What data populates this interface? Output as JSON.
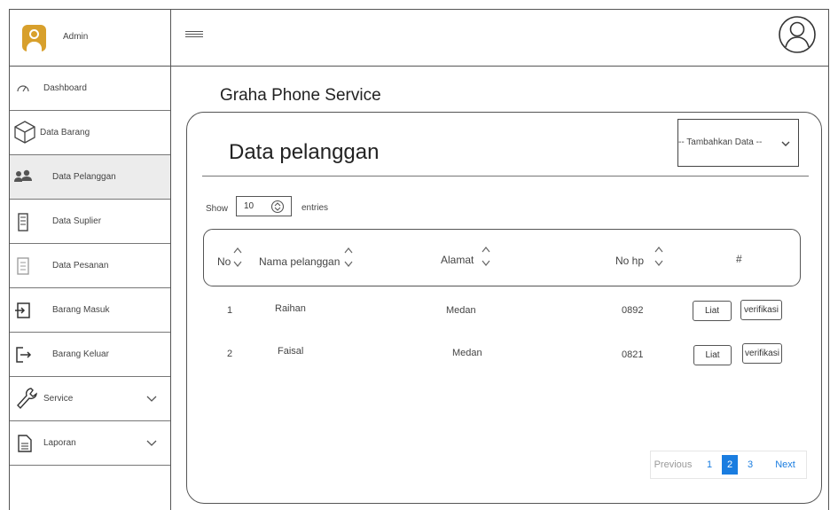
{
  "header": {
    "admin_label": "Admin"
  },
  "sidebar": {
    "items": [
      {
        "label": "Dashboard"
      },
      {
        "label": "Data Barang"
      },
      {
        "label": "Data Pelanggan"
      },
      {
        "label": "Data Suplier"
      },
      {
        "label": "Data Pesanan"
      },
      {
        "label": "Barang Masuk"
      },
      {
        "label": "Barang Keluar"
      },
      {
        "label": "Service"
      },
      {
        "label": "Laporan"
      }
    ],
    "active_item": "Data Pelanggan"
  },
  "main": {
    "app_title": "Graha Phone Service",
    "panel_title": "Data pelanggan",
    "add_select": "-- Tambahkan Data --",
    "show_label": "Show",
    "entries_value": "10",
    "entries_label": "entries"
  },
  "table": {
    "columns": [
      "No",
      "Nama pelanggan",
      "Alamat",
      "No hp",
      "#"
    ],
    "rows": [
      {
        "no": "1",
        "nama": "Raihan",
        "alamat": "Medan",
        "hp": "0892",
        "view": "Liat",
        "verify": "verifikasi"
      },
      {
        "no": "2",
        "nama": "Faisal",
        "alamat": "Medan",
        "hp": "0821",
        "view": "Liat",
        "verify": "verifikasi"
      }
    ]
  },
  "pagination": {
    "previous": "Previous",
    "pages": [
      "1",
      "2",
      "3"
    ],
    "current": "2",
    "next": "Next"
  },
  "colors": {
    "accent": "#1a7de0",
    "avatar": "#d8a02c",
    "active_row": "#ececec"
  }
}
